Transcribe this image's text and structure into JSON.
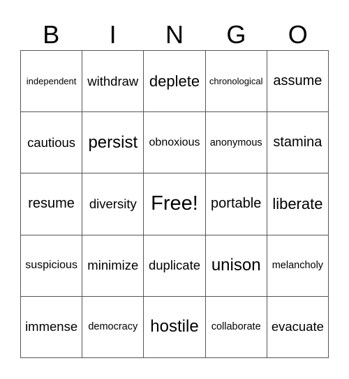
{
  "header": {
    "letters": [
      "B",
      "I",
      "N",
      "G",
      "O"
    ]
  },
  "grid": {
    "rows": [
      [
        "independent",
        "withdraw",
        "deplete",
        "chronological",
        "assume"
      ],
      [
        "cautious",
        "persist",
        "obnoxious",
        "anonymous",
        "stamina"
      ],
      [
        "resume",
        "diversity",
        "Free!",
        "portable",
        "liberate"
      ],
      [
        "suspicious",
        "minimize",
        "duplicate",
        "unison",
        "melancholy"
      ],
      [
        "immense",
        "democracy",
        "hostile",
        "collaborate",
        "evacuate"
      ]
    ]
  }
}
